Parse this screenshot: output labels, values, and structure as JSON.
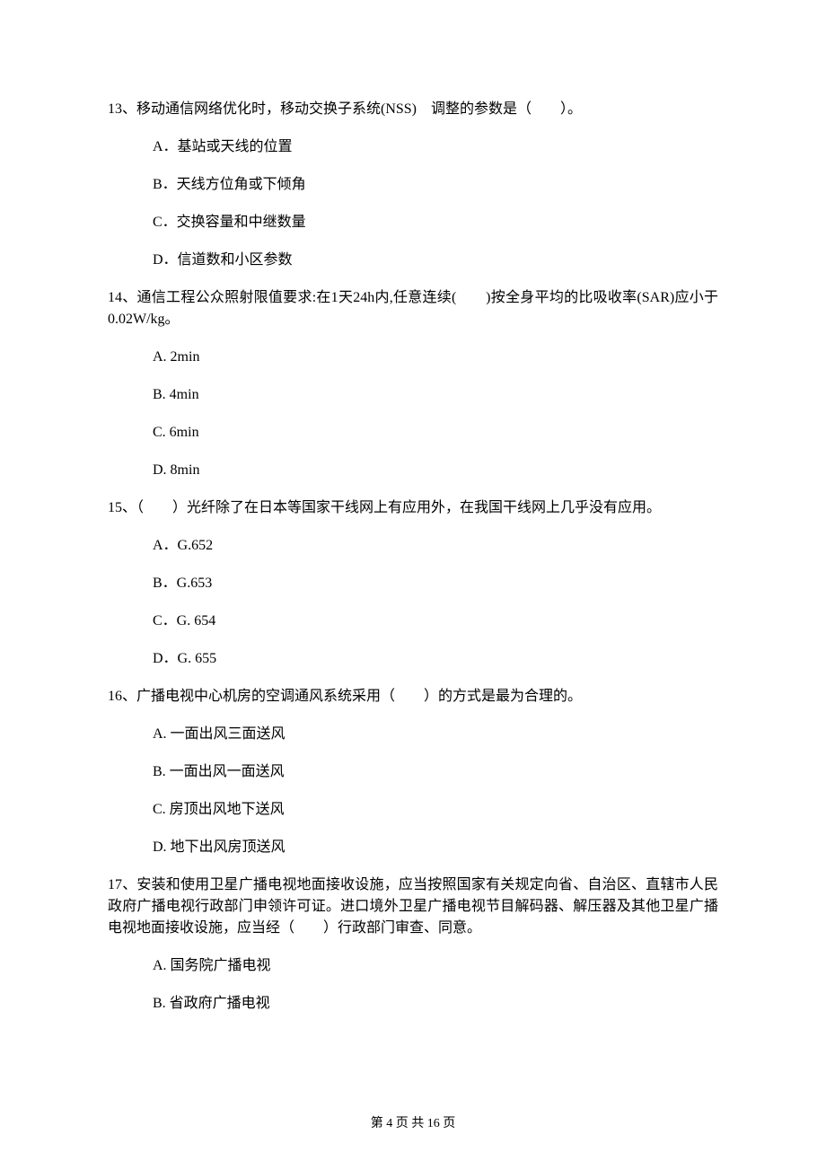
{
  "questions": [
    {
      "stem": "13、移动通信网络优化时，移动交换子系统(NSS)　调整的参数是（　　）。",
      "choices": [
        "A．基站或天线的位置",
        "B．天线方位角或下倾角",
        "C．交换容量和中继数量",
        "D．信道数和小区参数"
      ]
    },
    {
      "stem": "14、通信工程公众照射限值要求:在1天24h内,任意连续(　　)按全身平均的比吸收率(SAR)应小于0.02W/kg。",
      "choices": [
        "A. 2min",
        "B. 4min",
        "C. 6min",
        "D. 8min"
      ]
    },
    {
      "stem": "15、（　　）光纤除了在日本等国家干线网上有应用外，在我国干线网上几乎没有应用。",
      "choices": [
        "A．G.652",
        "B．G.653",
        "C．G. 654",
        "D．G. 655"
      ]
    },
    {
      "stem": "16、广播电视中心机房的空调通风系统采用（　　）的方式是最为合理的。",
      "choices": [
        "A. 一面出风三面送风",
        "B. 一面出风一面送风",
        "C. 房顶出风地下送风",
        "D. 地下出风房顶送风"
      ]
    },
    {
      "stem": "17、安装和使用卫星广播电视地面接收设施，应当按照国家有关规定向省、自治区、直辖市人民政府广播电视行政部门申领许可证。进口境外卫星广播电视节目解码器、解压器及其他卫星广播电视地面接收设施，应当经（　　）行政部门审查、同意。",
      "choices": [
        "A. 国务院广播电视",
        "B. 省政府广播电视"
      ]
    }
  ],
  "footer": "第 4 页 共 16 页"
}
